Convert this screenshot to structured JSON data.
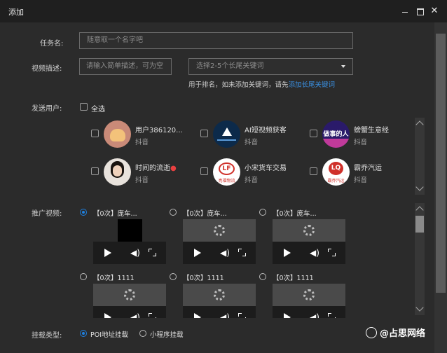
{
  "window": {
    "title": "添加",
    "close_glyph": "✕"
  },
  "form": {
    "task_name_label": "任务名:",
    "task_name_placeholder": "随意取一个名字吧",
    "desc_label": "视频描述:",
    "desc_placeholder": "请输入简单描述，可为空",
    "keyword_placeholder": "选择2-5个长尾关键词",
    "keyword_hint": "用于排名，如未添加关键词，请先",
    "keyword_hint_link": "添加长尾关键词",
    "users_label": "发送用户:",
    "select_all": "全选",
    "videos_label": "推广视频:",
    "mount_label": "挂载类型:"
  },
  "users": [
    {
      "name": "用户386120...",
      "platform": "抖音",
      "avatar": "bread"
    },
    {
      "name": "AI短视频获客",
      "platform": "抖音",
      "avatar": "ai-logo"
    },
    {
      "name": "螃蟹生意经",
      "platform": "抖音",
      "avatar": "做事的人",
      "avatar_text": "做事的人"
    },
    {
      "name": "时间的流逝",
      "platform": "抖音",
      "avatar": "portrait"
    },
    {
      "name": "小宋货车交易",
      "platform": "抖音",
      "avatar": "LF",
      "avatar_text": "LF",
      "avatar_sub": "亮福物流"
    },
    {
      "name": "霸乔汽运",
      "platform": "抖音",
      "avatar": "LQ",
      "avatar_text": "LQ",
      "avatar_sub": "霸乔汽运"
    }
  ],
  "videos": [
    {
      "caption": "【0次】庞车...",
      "selected": true,
      "state": "black"
    },
    {
      "caption": "【0次】庞车...",
      "selected": false,
      "state": "loading"
    },
    {
      "caption": "【0次】庞车...",
      "selected": false,
      "state": "loading"
    },
    {
      "caption": "【0次】1111",
      "selected": false,
      "state": "loading"
    },
    {
      "caption": "【0次】1111",
      "selected": false,
      "state": "loading"
    },
    {
      "caption": "【0次】1111",
      "selected": false,
      "state": "loading"
    }
  ],
  "mount_options": [
    {
      "label": "POI地址挂载",
      "selected": true
    },
    {
      "label": "小程序挂载",
      "selected": false
    }
  ],
  "watermark": "@占思网络",
  "colors": {
    "accent": "#1e80e0",
    "link": "#3a8fe0",
    "background": "#2b2b2b"
  }
}
